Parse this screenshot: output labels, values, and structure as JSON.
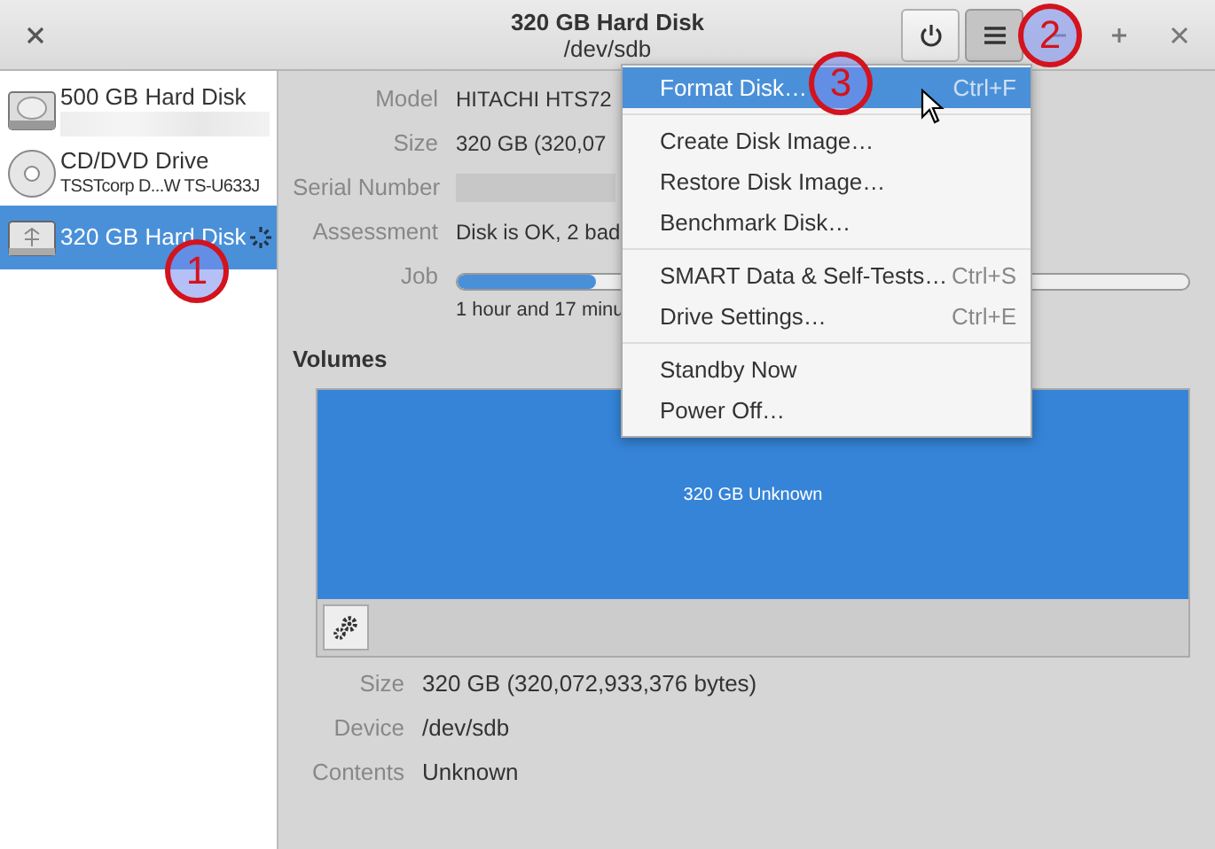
{
  "window": {
    "title": "320 GB Hard Disk",
    "subtitle": "/dev/sdb"
  },
  "drives": [
    {
      "name": "500 GB Hard Disk",
      "kind": "hdd",
      "redacted": true,
      "selected": false,
      "busy": false
    },
    {
      "name": "CD/DVD Drive",
      "detail": "TSSTcorp D...W TS-U633J",
      "kind": "optical",
      "redacted": false,
      "selected": false,
      "busy": false
    },
    {
      "name": "320 GB Hard Disk",
      "kind": "usb",
      "redacted": false,
      "selected": true,
      "busy": true
    }
  ],
  "drive_info": [
    {
      "label": "Model",
      "value": "HITACHI HTS72",
      "redacted": false
    },
    {
      "label": "Size",
      "value": "320 GB (320,07",
      "redacted": false
    },
    {
      "label": "Serial Number",
      "redacted": true
    },
    {
      "label": "Assessment",
      "value": "Disk is OK, 2 bad",
      "redacted": false
    }
  ],
  "job": {
    "label": "Job",
    "level": 0.19,
    "text": "1 hour and 17 minu"
  },
  "volumes": {
    "heading": "Volumes",
    "partition": "320 GB Unknown",
    "info": [
      {
        "label": "Size",
        "value": "320 GB (320,072,933,376 bytes)"
      },
      {
        "label": "Device",
        "value": "/dev/sdb"
      },
      {
        "label": "Contents",
        "value": "Unknown"
      }
    ]
  },
  "menu": {
    "open": true,
    "groups": [
      [
        {
          "label": "Format Disk…",
          "shortcut": "Ctrl+F",
          "selected": true
        }
      ],
      [
        {
          "label": "Create Disk Image…",
          "selected": false
        },
        {
          "label": "Restore Disk Image…",
          "selected": false
        },
        {
          "label": "Benchmark Disk…",
          "selected": false
        }
      ],
      [
        {
          "label": "SMART Data & Self-Tests…",
          "shortcut": "Ctrl+S",
          "selected": false
        },
        {
          "label": "Drive Settings…",
          "shortcut": "Ctrl+E",
          "selected": false
        }
      ],
      [
        {
          "label": "Standby Now",
          "selected": false
        },
        {
          "label": "Power Off…",
          "selected": false
        }
      ]
    ]
  },
  "annotations": [
    {
      "number": "1"
    },
    {
      "number": "2"
    },
    {
      "number": "3"
    }
  ]
}
